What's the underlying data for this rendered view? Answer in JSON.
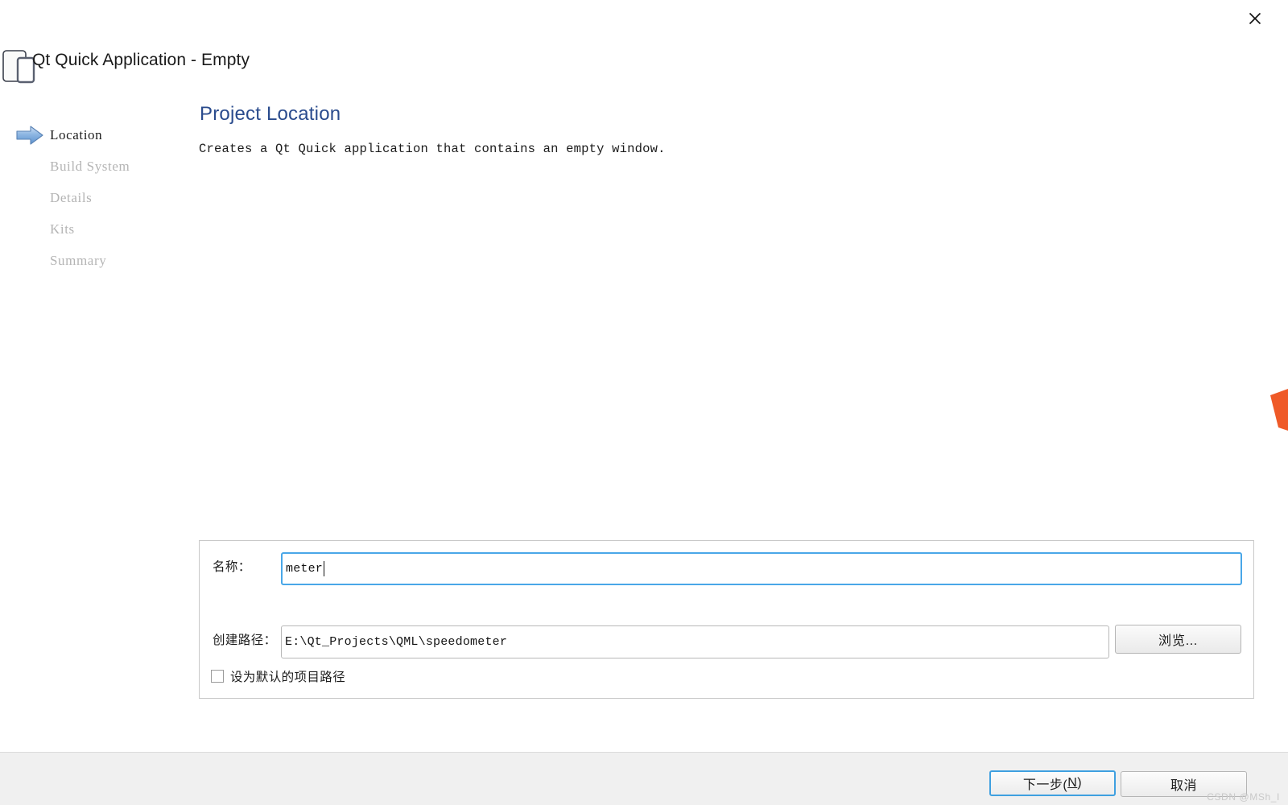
{
  "window": {
    "title": "Qt Quick Application - Empty",
    "close_label": "×"
  },
  "sidebar": {
    "items": [
      {
        "label": "Location",
        "active": true
      },
      {
        "label": "Build System",
        "active": false
      },
      {
        "label": "Details",
        "active": false
      },
      {
        "label": "Kits",
        "active": false
      },
      {
        "label": "Summary",
        "active": false
      }
    ]
  },
  "main": {
    "page_title": "Project Location",
    "description": "Creates a Qt Quick application that contains an empty window."
  },
  "form": {
    "name_label": "名称：",
    "name_value": "meter",
    "name_placeholder": "",
    "path_label": "创建路径：",
    "path_value": "E:\\Qt_Projects\\QML\\speedometer",
    "path_placeholder": "",
    "browse_label": "浏览...",
    "default_path_label": "设为默认的项目路径",
    "default_path_checked": false
  },
  "footer": {
    "next_label": "下一步(",
    "next_accel": "N",
    "next_label_end": ")",
    "cancel_label": "取消"
  },
  "watermark": {
    "text": "CSDN @MSh_I"
  },
  "colors": {
    "accent_blue": "#2a4b8d",
    "focus_blue": "#49a7e8",
    "footer_bg": "#f0f0f0",
    "orange_marker": "#ef5a28",
    "inactive_step": "#b4b4b4"
  }
}
